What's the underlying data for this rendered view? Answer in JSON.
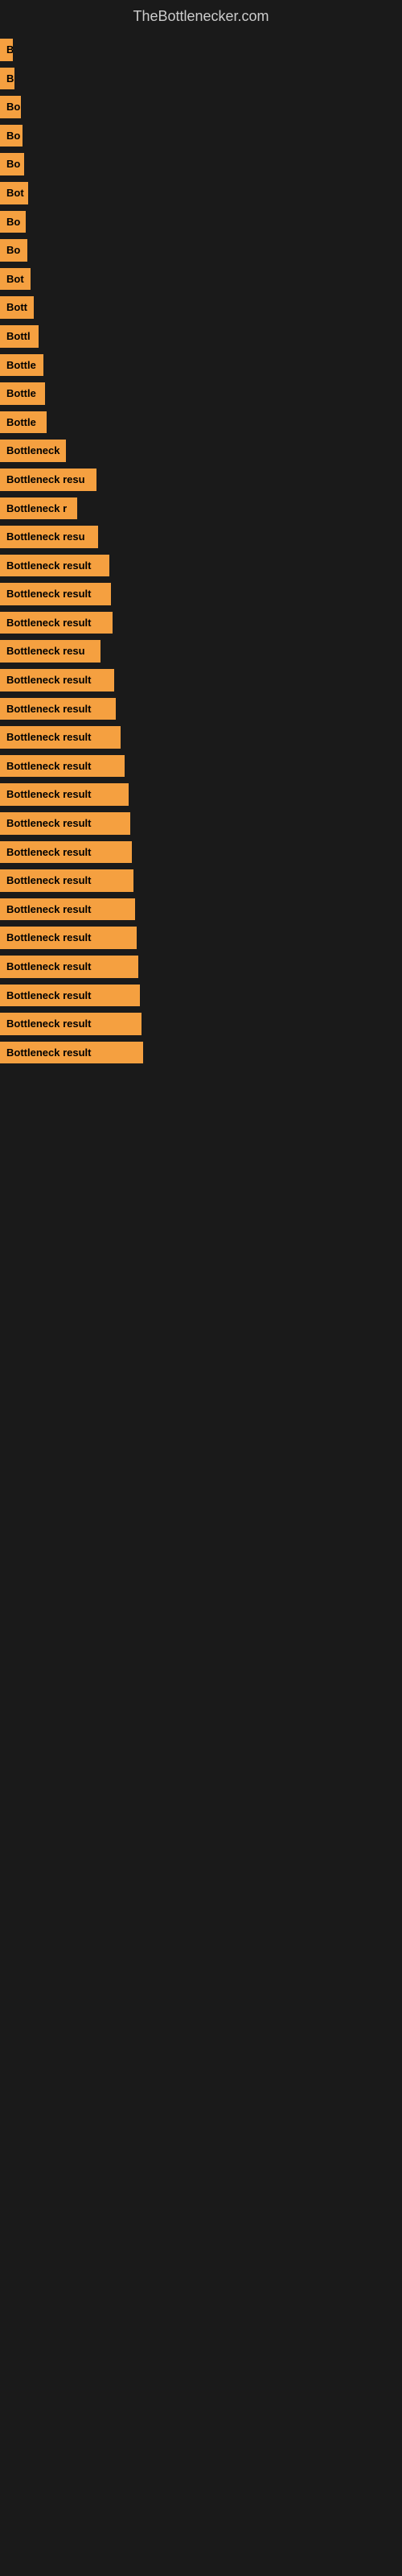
{
  "site": {
    "title": "TheBottlenecker.com"
  },
  "items": [
    {
      "label": "B",
      "width": 14
    },
    {
      "label": "B",
      "width": 18
    },
    {
      "label": "Bo",
      "width": 26
    },
    {
      "label": "Bo",
      "width": 28
    },
    {
      "label": "Bo",
      "width": 30
    },
    {
      "label": "Bot",
      "width": 35
    },
    {
      "label": "Bo",
      "width": 32
    },
    {
      "label": "Bo",
      "width": 34
    },
    {
      "label": "Bot",
      "width": 38
    },
    {
      "label": "Bott",
      "width": 42
    },
    {
      "label": "Bottl",
      "width": 48
    },
    {
      "label": "Bottle",
      "width": 54
    },
    {
      "label": "Bottle",
      "width": 56
    },
    {
      "label": "Bottle",
      "width": 58
    },
    {
      "label": "Bottleneck",
      "width": 82
    },
    {
      "label": "Bottleneck resu",
      "width": 120
    },
    {
      "label": "Bottleneck r",
      "width": 96
    },
    {
      "label": "Bottleneck resu",
      "width": 122
    },
    {
      "label": "Bottleneck result",
      "width": 136
    },
    {
      "label": "Bottleneck result",
      "width": 138
    },
    {
      "label": "Bottleneck result",
      "width": 140
    },
    {
      "label": "Bottleneck resu",
      "width": 125
    },
    {
      "label": "Bottleneck result",
      "width": 142
    },
    {
      "label": "Bottleneck result",
      "width": 144
    },
    {
      "label": "Bottleneck result",
      "width": 150
    },
    {
      "label": "Bottleneck result",
      "width": 155
    },
    {
      "label": "Bottleneck result",
      "width": 160
    },
    {
      "label": "Bottleneck result",
      "width": 162
    },
    {
      "label": "Bottleneck result",
      "width": 164
    },
    {
      "label": "Bottleneck result",
      "width": 166
    },
    {
      "label": "Bottleneck result",
      "width": 168
    },
    {
      "label": "Bottleneck result",
      "width": 170
    },
    {
      "label": "Bottleneck result",
      "width": 172
    },
    {
      "label": "Bottleneck result",
      "width": 174
    },
    {
      "label": "Bottleneck result",
      "width": 176
    },
    {
      "label": "Bottleneck result",
      "width": 178
    }
  ]
}
